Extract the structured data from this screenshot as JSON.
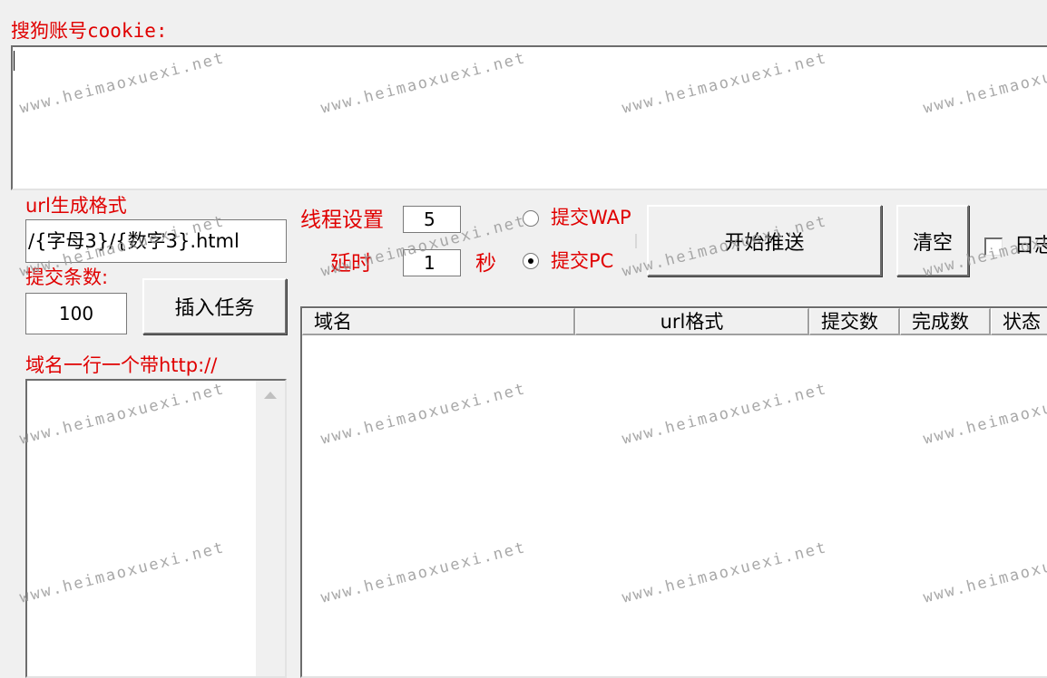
{
  "cookie": {
    "label": "搜狗账号cookie:",
    "value": ""
  },
  "url_format": {
    "label": "url生成格式",
    "value": "/{字母3}/{数字3}.html"
  },
  "submit_count": {
    "label": "提交条数:",
    "value": "100"
  },
  "insert_task_label": "插入任务",
  "domains": {
    "label": "域名一行一个带http://",
    "value": ""
  },
  "threads": {
    "label": "线程设置",
    "value": "5"
  },
  "delay": {
    "label": "延时",
    "value": "1",
    "unit": "秒"
  },
  "submit_mode": {
    "options": [
      {
        "label": "提交WAP",
        "selected": false
      },
      {
        "label": "提交PC",
        "selected": true
      }
    ]
  },
  "start_push_label": "开始推送",
  "clear_label": "清空",
  "log_checkbox": {
    "label": "日志",
    "checked": false
  },
  "task_table": {
    "columns": [
      "域名",
      "url格式",
      "提交数",
      "完成数",
      "状态"
    ],
    "rows": []
  },
  "watermark": "www.heimaoxuexi.net"
}
